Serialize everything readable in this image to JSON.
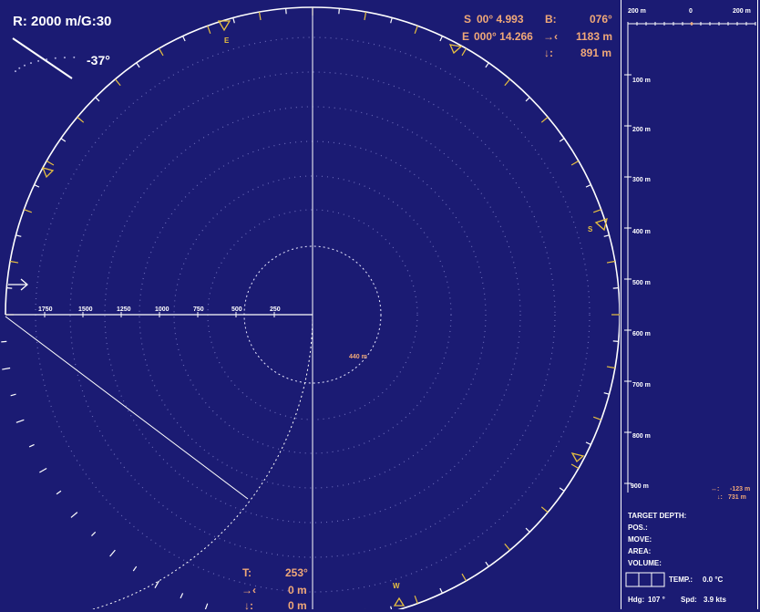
{
  "range_gain": "R: 2000 m/G:30",
  "tilt": "-37°",
  "position": {
    "lat_label": "S",
    "lat_value": "00° 4.993",
    "lon_label": "E",
    "lon_value": "000° 14.266",
    "bearing_label": "B:",
    "bearing_value": "076°",
    "horizontal_icon": "horizontal-range-arrow-icon",
    "horizontal_value": "1183 m",
    "depth_icon": "depth-arrow-icon",
    "depth_value": "891 m"
  },
  "compass_markers": {
    "east": "E",
    "south": "S",
    "west": "W"
  },
  "range_scale": [
    "1750",
    "1500",
    "1250",
    "1000",
    "750",
    "500",
    "250"
  ],
  "target_range_label": "440 m",
  "target": {
    "t_label": "T:",
    "t_value": "253°",
    "horizontal_value": "0 m",
    "depth_value": "0 m"
  },
  "side_panel": {
    "top_scale": [
      "200 m",
      "0",
      "200 m"
    ],
    "depth_scale": [
      "100 m",
      "200 m",
      "300 m",
      "400 m",
      "500 m",
      "600 m",
      "700 m",
      "800 m",
      "900 m"
    ],
    "cursor_horizontal": "-123 m",
    "cursor_depth": "731 m",
    "target_depth_label": "TARGET DEPTH:",
    "pos_label": "POS.:",
    "move_label": "MOVE:",
    "area_label": "AREA:",
    "volume_label": "VOLUME:",
    "temp_label": "TEMP.:",
    "temp_value": "0.0 °C",
    "hdg_label": "Hdg:",
    "hdg_value": "107 °",
    "spd_label": "Spd:",
    "spd_value": "3.9 kts"
  },
  "colors": {
    "background": "#1b1b73",
    "line": "#ffffff",
    "accent": "#f0a878",
    "marker": "#e8c040",
    "range_rings": "#6a6ab8"
  }
}
